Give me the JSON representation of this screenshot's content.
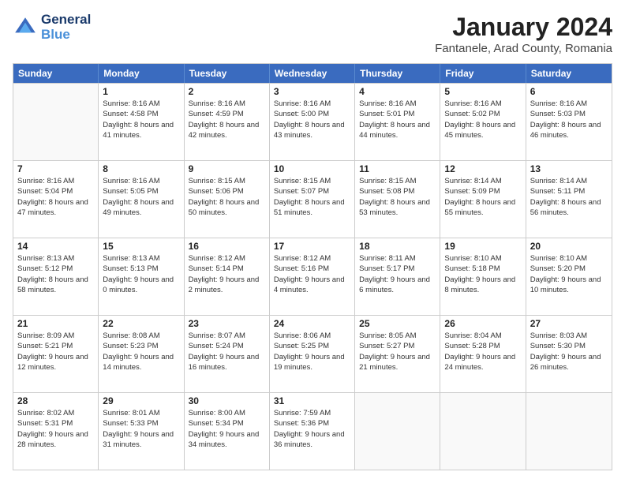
{
  "header": {
    "logo": {
      "line1": "General",
      "line2": "Blue"
    },
    "title": "January 2024",
    "subtitle": "Fantanele, Arad County, Romania"
  },
  "days_of_week": [
    "Sunday",
    "Monday",
    "Tuesday",
    "Wednesday",
    "Thursday",
    "Friday",
    "Saturday"
  ],
  "weeks": [
    [
      {
        "day": "",
        "sunrise": "",
        "sunset": "",
        "daylight": "",
        "empty": true
      },
      {
        "day": "1",
        "sunrise": "Sunrise: 8:16 AM",
        "sunset": "Sunset: 4:58 PM",
        "daylight": "Daylight: 8 hours and 41 minutes."
      },
      {
        "day": "2",
        "sunrise": "Sunrise: 8:16 AM",
        "sunset": "Sunset: 4:59 PM",
        "daylight": "Daylight: 8 hours and 42 minutes."
      },
      {
        "day": "3",
        "sunrise": "Sunrise: 8:16 AM",
        "sunset": "Sunset: 5:00 PM",
        "daylight": "Daylight: 8 hours and 43 minutes."
      },
      {
        "day": "4",
        "sunrise": "Sunrise: 8:16 AM",
        "sunset": "Sunset: 5:01 PM",
        "daylight": "Daylight: 8 hours and 44 minutes."
      },
      {
        "day": "5",
        "sunrise": "Sunrise: 8:16 AM",
        "sunset": "Sunset: 5:02 PM",
        "daylight": "Daylight: 8 hours and 45 minutes."
      },
      {
        "day": "6",
        "sunrise": "Sunrise: 8:16 AM",
        "sunset": "Sunset: 5:03 PM",
        "daylight": "Daylight: 8 hours and 46 minutes."
      }
    ],
    [
      {
        "day": "7",
        "sunrise": "Sunrise: 8:16 AM",
        "sunset": "Sunset: 5:04 PM",
        "daylight": "Daylight: 8 hours and 47 minutes."
      },
      {
        "day": "8",
        "sunrise": "Sunrise: 8:16 AM",
        "sunset": "Sunset: 5:05 PM",
        "daylight": "Daylight: 8 hours and 49 minutes."
      },
      {
        "day": "9",
        "sunrise": "Sunrise: 8:15 AM",
        "sunset": "Sunset: 5:06 PM",
        "daylight": "Daylight: 8 hours and 50 minutes."
      },
      {
        "day": "10",
        "sunrise": "Sunrise: 8:15 AM",
        "sunset": "Sunset: 5:07 PM",
        "daylight": "Daylight: 8 hours and 51 minutes."
      },
      {
        "day": "11",
        "sunrise": "Sunrise: 8:15 AM",
        "sunset": "Sunset: 5:08 PM",
        "daylight": "Daylight: 8 hours and 53 minutes."
      },
      {
        "day": "12",
        "sunrise": "Sunrise: 8:14 AM",
        "sunset": "Sunset: 5:09 PM",
        "daylight": "Daylight: 8 hours and 55 minutes."
      },
      {
        "day": "13",
        "sunrise": "Sunrise: 8:14 AM",
        "sunset": "Sunset: 5:11 PM",
        "daylight": "Daylight: 8 hours and 56 minutes."
      }
    ],
    [
      {
        "day": "14",
        "sunrise": "Sunrise: 8:13 AM",
        "sunset": "Sunset: 5:12 PM",
        "daylight": "Daylight: 8 hours and 58 minutes."
      },
      {
        "day": "15",
        "sunrise": "Sunrise: 8:13 AM",
        "sunset": "Sunset: 5:13 PM",
        "daylight": "Daylight: 9 hours and 0 minutes."
      },
      {
        "day": "16",
        "sunrise": "Sunrise: 8:12 AM",
        "sunset": "Sunset: 5:14 PM",
        "daylight": "Daylight: 9 hours and 2 minutes."
      },
      {
        "day": "17",
        "sunrise": "Sunrise: 8:12 AM",
        "sunset": "Sunset: 5:16 PM",
        "daylight": "Daylight: 9 hours and 4 minutes."
      },
      {
        "day": "18",
        "sunrise": "Sunrise: 8:11 AM",
        "sunset": "Sunset: 5:17 PM",
        "daylight": "Daylight: 9 hours and 6 minutes."
      },
      {
        "day": "19",
        "sunrise": "Sunrise: 8:10 AM",
        "sunset": "Sunset: 5:18 PM",
        "daylight": "Daylight: 9 hours and 8 minutes."
      },
      {
        "day": "20",
        "sunrise": "Sunrise: 8:10 AM",
        "sunset": "Sunset: 5:20 PM",
        "daylight": "Daylight: 9 hours and 10 minutes."
      }
    ],
    [
      {
        "day": "21",
        "sunrise": "Sunrise: 8:09 AM",
        "sunset": "Sunset: 5:21 PM",
        "daylight": "Daylight: 9 hours and 12 minutes."
      },
      {
        "day": "22",
        "sunrise": "Sunrise: 8:08 AM",
        "sunset": "Sunset: 5:23 PM",
        "daylight": "Daylight: 9 hours and 14 minutes."
      },
      {
        "day": "23",
        "sunrise": "Sunrise: 8:07 AM",
        "sunset": "Sunset: 5:24 PM",
        "daylight": "Daylight: 9 hours and 16 minutes."
      },
      {
        "day": "24",
        "sunrise": "Sunrise: 8:06 AM",
        "sunset": "Sunset: 5:25 PM",
        "daylight": "Daylight: 9 hours and 19 minutes."
      },
      {
        "day": "25",
        "sunrise": "Sunrise: 8:05 AM",
        "sunset": "Sunset: 5:27 PM",
        "daylight": "Daylight: 9 hours and 21 minutes."
      },
      {
        "day": "26",
        "sunrise": "Sunrise: 8:04 AM",
        "sunset": "Sunset: 5:28 PM",
        "daylight": "Daylight: 9 hours and 24 minutes."
      },
      {
        "day": "27",
        "sunrise": "Sunrise: 8:03 AM",
        "sunset": "Sunset: 5:30 PM",
        "daylight": "Daylight: 9 hours and 26 minutes."
      }
    ],
    [
      {
        "day": "28",
        "sunrise": "Sunrise: 8:02 AM",
        "sunset": "Sunset: 5:31 PM",
        "daylight": "Daylight: 9 hours and 28 minutes."
      },
      {
        "day": "29",
        "sunrise": "Sunrise: 8:01 AM",
        "sunset": "Sunset: 5:33 PM",
        "daylight": "Daylight: 9 hours and 31 minutes."
      },
      {
        "day": "30",
        "sunrise": "Sunrise: 8:00 AM",
        "sunset": "Sunset: 5:34 PM",
        "daylight": "Daylight: 9 hours and 34 minutes."
      },
      {
        "day": "31",
        "sunrise": "Sunrise: 7:59 AM",
        "sunset": "Sunset: 5:36 PM",
        "daylight": "Daylight: 9 hours and 36 minutes."
      },
      {
        "day": "",
        "sunrise": "",
        "sunset": "",
        "daylight": "",
        "empty": true
      },
      {
        "day": "",
        "sunrise": "",
        "sunset": "",
        "daylight": "",
        "empty": true
      },
      {
        "day": "",
        "sunrise": "",
        "sunset": "",
        "daylight": "",
        "empty": true
      }
    ]
  ]
}
